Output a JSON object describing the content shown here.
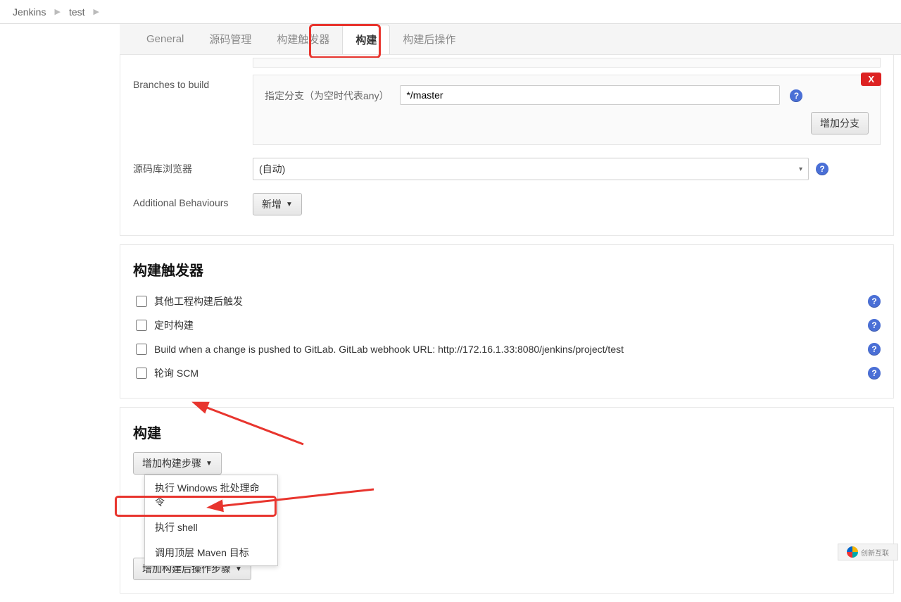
{
  "breadcrumb": {
    "root": "Jenkins",
    "item": "test"
  },
  "tabs": {
    "general": "General",
    "scm": "源码管理",
    "triggers_tab": "构建触发器",
    "build": "构建",
    "post": "构建后操作"
  },
  "scm": {
    "branches_label": "Branches to build",
    "branch_spec_label": "指定分支（为空时代表any）",
    "branch_value": "*/master",
    "add_branch_btn": "增加分支",
    "close_btn": "X",
    "repo_browser_label": "源码库浏览器",
    "repo_browser_value": "(自动)",
    "additional_label": "Additional Behaviours",
    "additional_btn": "新增"
  },
  "triggers": {
    "title": "构建触发器",
    "items": [
      "其他工程构建后触发",
      "定时构建",
      "Build when a change is pushed to GitLab. GitLab webhook URL: http://172.16.1.33:8080/jenkins/project/test",
      "轮询 SCM"
    ]
  },
  "build": {
    "title": "构建",
    "add_step_btn": "增加构建步骤",
    "post_btn_stub": "增加构建后操作步骤",
    "menu": {
      "win": "执行 Windows 批处理命令",
      "shell": "执行 shell",
      "maven": "调用顶层 Maven 目标"
    }
  },
  "watermark": "创新互联"
}
